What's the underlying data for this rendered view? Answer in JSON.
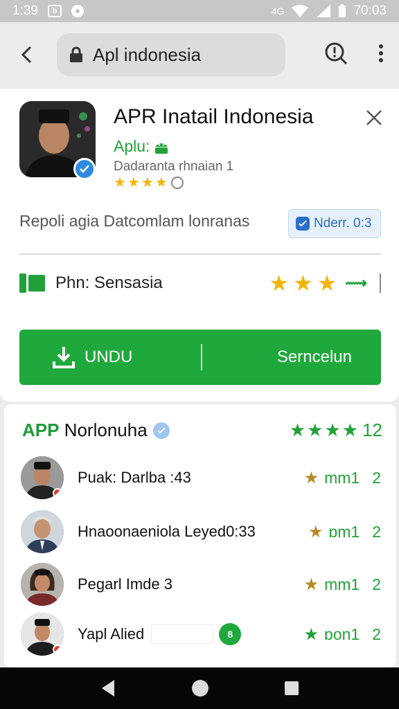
{
  "status_bar": {
    "time": "1:39",
    "notif_letter": "b",
    "signal": "4G",
    "clock_right": "70:03"
  },
  "browser": {
    "url": "Apl indonesia"
  },
  "app": {
    "title": "APR Inatail Indonesia",
    "subtitle": "Aplu:",
    "developer": "Dadaranta rhnaian 1",
    "rating_stars": 4,
    "description": "Repoli agia Datcomlam lonranas",
    "badge": "Nderr. 0:3",
    "provider_label": "Phn: Sensasia",
    "provider_stars": 3,
    "download_label": "UNDU",
    "secondary_label": "Serncelun"
  },
  "reviews": {
    "title_prefix": "APP",
    "title_rest": " Norlonuha",
    "score_stars": 4,
    "score_value": "12",
    "items": [
      {
        "name": "Puak: Darlba :43",
        "meta": "mm1",
        "count": "2",
        "star_color": "gold"
      },
      {
        "name": "Hnaoonaeniola Leyed0:33",
        "meta": "ɒm1",
        "count": "2",
        "star_color": "gold"
      },
      {
        "name": "Pegarl Imde 3",
        "meta": "mm1",
        "count": "2",
        "star_color": "gold"
      },
      {
        "name": "Yapl Alied",
        "meta": "ɒon1",
        "count": "2",
        "star_color": "green"
      }
    ]
  },
  "colors": {
    "accent_green": "#1fa83b",
    "star_gold": "#f2b50c",
    "verify_blue": "#2f8be0"
  },
  "icons": [
    "back-arrow-icon",
    "lock-icon",
    "search-icon",
    "more-vert-icon",
    "close-icon",
    "download-icon",
    "android-icon",
    "globe-icon",
    "back-nav-icon",
    "home-nav-icon",
    "recents-nav-icon"
  ]
}
